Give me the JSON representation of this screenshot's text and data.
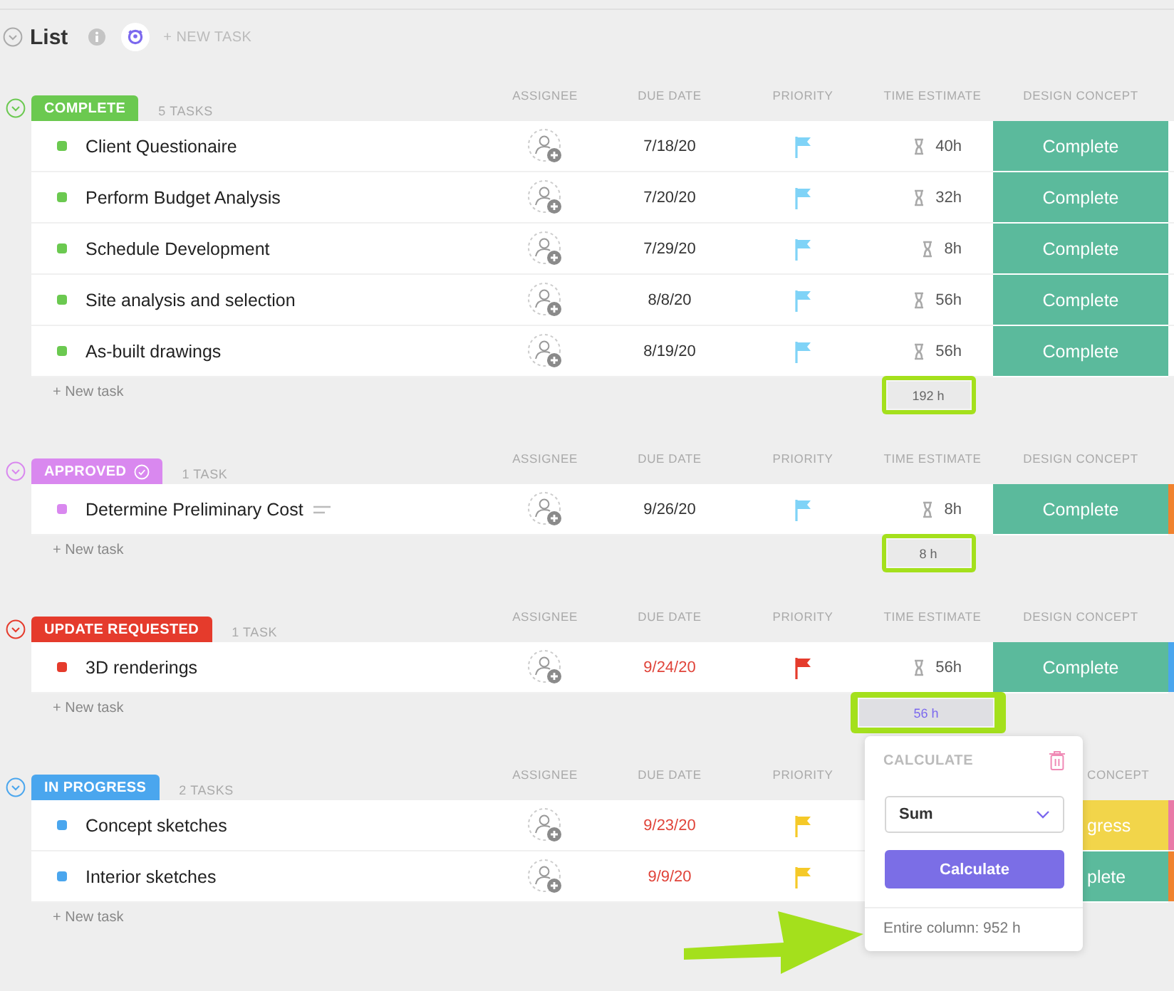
{
  "header": {
    "title": "List",
    "new_task": "+ NEW TASK"
  },
  "groups": [
    {
      "status": "COMPLETE",
      "color": "#6bc950",
      "done": false,
      "count": "5 TASKS",
      "columns": {
        "assignee": "ASSIGNEE",
        "due_date": "DUE DATE",
        "priority": "PRIORITY",
        "time_estimate": "TIME ESTIMATE",
        "design_concept": "DESIGN CONCEPT"
      },
      "rows": [
        {
          "name": "Client Questionaire",
          "has_description": false,
          "due": "7/18/20",
          "overdue": false,
          "kind": "normal",
          "time": "40h",
          "concept": {
            "label": "Complete",
            "color": "#5bba9c"
          }
        },
        {
          "name": "Perform Budget Analysis",
          "has_description": false,
          "due": "7/20/20",
          "overdue": false,
          "kind": "normal",
          "time": "32h",
          "concept": {
            "label": "Complete",
            "color": "#5bba9c"
          }
        },
        {
          "name": "Schedule Development",
          "has_description": false,
          "due": "7/29/20",
          "overdue": false,
          "kind": "normal",
          "time": "8h",
          "concept": {
            "label": "Complete",
            "color": "#5bba9c"
          }
        },
        {
          "name": "Site analysis and selection",
          "has_description": false,
          "due": "8/8/20",
          "overdue": false,
          "kind": "normal",
          "time": "56h",
          "concept": {
            "label": "Complete",
            "color": "#5bba9c"
          }
        },
        {
          "name": "As-built drawings",
          "has_description": false,
          "due": "8/19/20",
          "overdue": false,
          "kind": "normal",
          "time": "56h",
          "concept": {
            "label": "Complete",
            "color": "#5bba9c"
          }
        }
      ],
      "new_task": "+ New task",
      "summary": {
        "text": "192 h",
        "highlighted": true,
        "active": false
      }
    },
    {
      "status": "APPROVED",
      "color": "#d988ef",
      "done": true,
      "count": "1 TASK",
      "columns": {
        "assignee": "ASSIGNEE",
        "due_date": "DUE DATE",
        "priority": "PRIORITY",
        "time_estimate": "TIME ESTIMATE",
        "design_concept": "DESIGN CONCEPT"
      },
      "rows": [
        {
          "name": "Determine Preliminary Cost",
          "has_description": true,
          "due": "9/26/20",
          "overdue": false,
          "kind": "normal",
          "time": "8h",
          "concept": {
            "label": "Complete",
            "color": "#5bba9c"
          },
          "color": "#f0822e"
        }
      ],
      "new_task": "+ New task",
      "summary": {
        "text": "8 h",
        "highlighted": true,
        "active": false
      }
    },
    {
      "status": "UPDATE REQUESTED",
      "color": "#e53b2c",
      "done": false,
      "count": "1 TASK",
      "columns": {
        "assignee": "ASSIGNEE",
        "due_date": "DUE DATE",
        "priority": "PRIORITY",
        "time_estimate": "TIME ESTIMATE",
        "design_concept": "DESIGN CONCEPT"
      },
      "rows": [
        {
          "name": "3D renderings",
          "has_description": false,
          "due": "9/24/20",
          "overdue": true,
          "kind": "urgent",
          "time": "56h",
          "concept": {
            "label": "Complete",
            "color": "#5bba9c"
          },
          "color": "#4aa6ee"
        }
      ],
      "new_task": "+ New task",
      "summary": {
        "text": "56 h",
        "highlighted": true,
        "active": true
      }
    },
    {
      "status": "IN PROGRESS",
      "color": "#4aa6ee",
      "done": false,
      "count": "2 TASKS",
      "columns": {
        "assignee": "ASSIGNEE",
        "due_date": "DUE DATE",
        "priority": "PRIORITY",
        "design_concept": "CONCEPT"
      },
      "rows": [
        {
          "name": "Concept sketches",
          "has_description": false,
          "due": "9/23/20",
          "overdue": true,
          "kind": "high",
          "concept": {
            "label": "gress",
            "color": "#f2d54a"
          },
          "color": "#e97aa7"
        },
        {
          "name": "Interior sketches",
          "has_description": false,
          "due": "9/9/20",
          "overdue": true,
          "kind": "high",
          "concept": {
            "label": "plete",
            "color": "#5bba9c"
          },
          "color": "#f0822e"
        }
      ],
      "new_task": "+ New task"
    }
  ],
  "popup": {
    "title": "CALCULATE",
    "select": "Sum",
    "button": "Calculate",
    "footer": "Entire column: 952 h"
  }
}
